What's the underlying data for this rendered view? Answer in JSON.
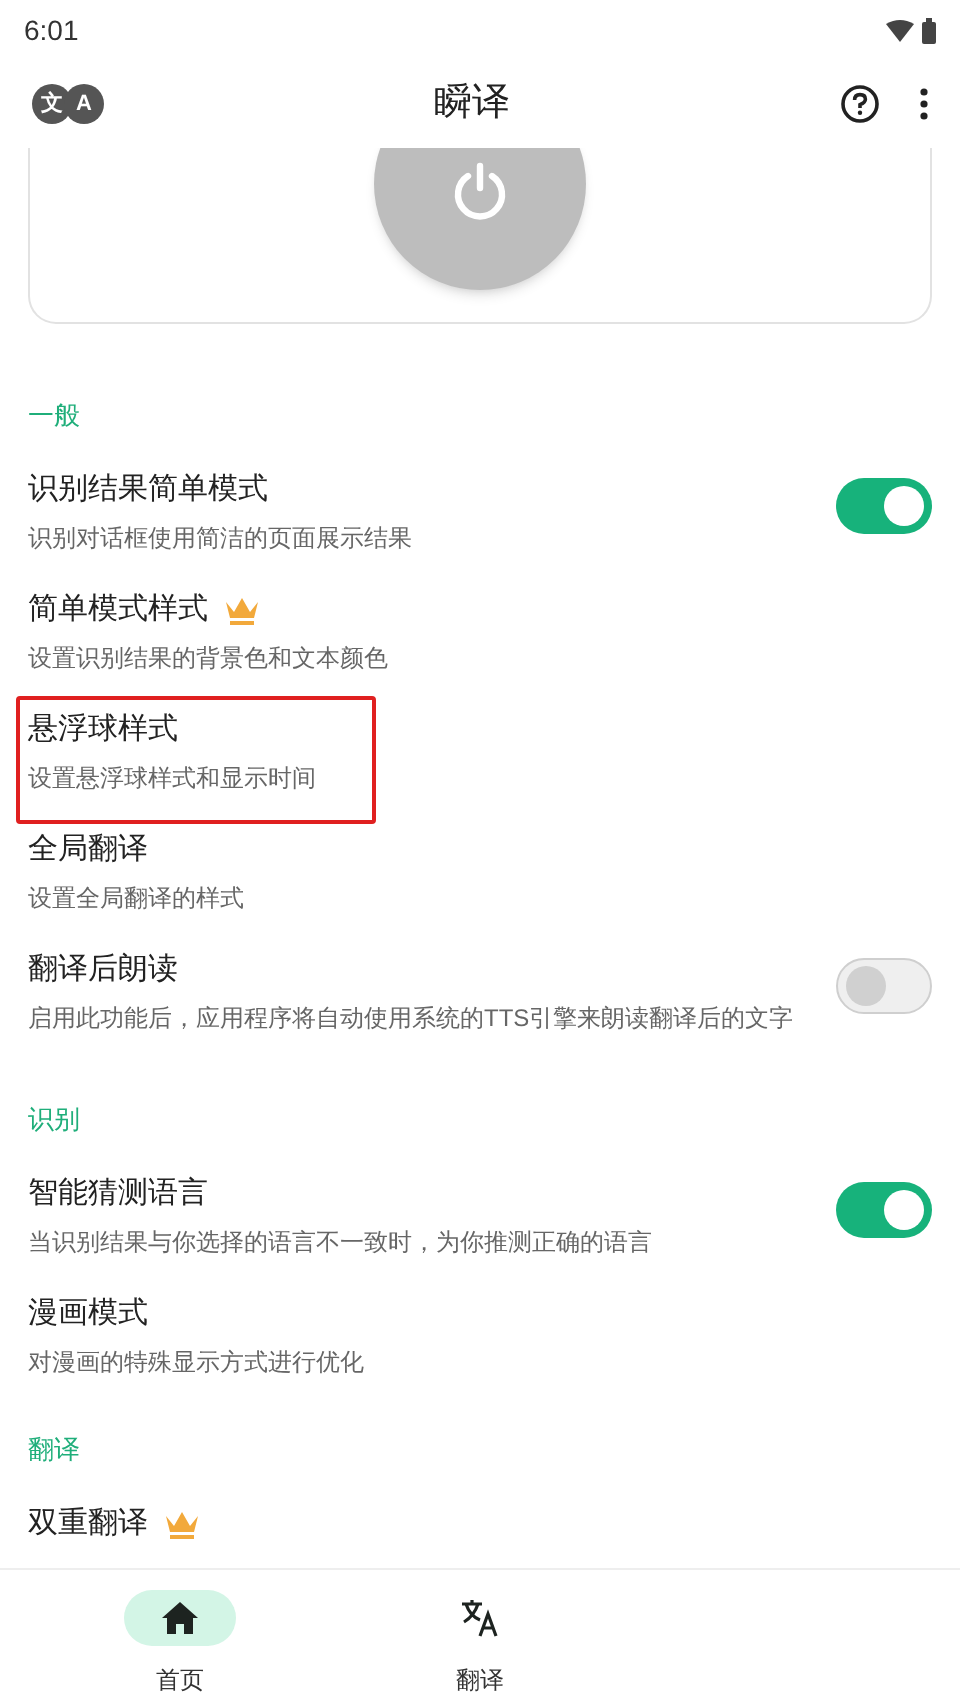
{
  "status_bar": {
    "time": "6:01"
  },
  "app_bar": {
    "logo": [
      "文",
      "A"
    ],
    "title": "瞬译"
  },
  "sections": [
    {
      "title": "一般",
      "items": [
        {
          "kind": "switch",
          "title": "识别结果简单模式",
          "subtitle": "识别对话框使用简洁的页面展示结果",
          "on": true
        },
        {
          "kind": "plain",
          "title": "简单模式样式",
          "subtitle": "设置识别结果的背景色和文本颜色",
          "premium": true
        },
        {
          "kind": "plain",
          "title": "悬浮球样式",
          "subtitle": "设置悬浮球样式和显示时间",
          "highlighted": true
        },
        {
          "kind": "plain",
          "title": "全局翻译",
          "subtitle": "设置全局翻译的样式"
        },
        {
          "kind": "switch",
          "title": "翻译后朗读",
          "subtitle": "启用此功能后，应用程序将自动使用系统的TTS引擎来朗读翻译后的文字",
          "on": false
        }
      ]
    },
    {
      "title": "识别",
      "items": [
        {
          "kind": "switch",
          "title": "智能猜测语言",
          "subtitle": "当识别结果与你选择的语言不一致时，为你推测正确的语言",
          "on": true
        },
        {
          "kind": "plain",
          "title": "漫画模式",
          "subtitle": "对漫画的特殊显示方式进行优化"
        }
      ]
    },
    {
      "title": "翻译",
      "items": [
        {
          "kind": "plain",
          "title": "双重翻译",
          "premium": true
        }
      ]
    }
  ],
  "bottom_nav": [
    {
      "label": "首页",
      "kind": "home",
      "selected": true
    },
    {
      "label": "翻译",
      "kind": "translate",
      "selected": false
    }
  ]
}
